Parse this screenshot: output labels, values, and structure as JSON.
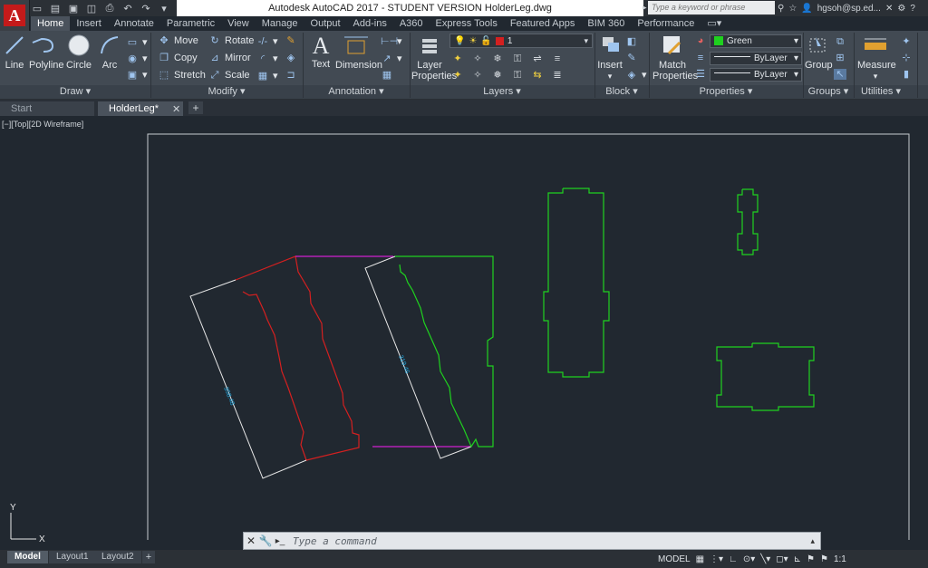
{
  "app": {
    "logo_letter": "A",
    "window_title": "Autodesk AutoCAD 2017 - STUDENT VERSION    HolderLeg.dwg",
    "search_placeholder": "Type a keyword or phrase",
    "user": "hgsoh@sp.ed...",
    "qat_icons": [
      "new-icon",
      "open-icon",
      "save-icon",
      "saveas-icon",
      "print-icon",
      "undo-icon",
      "redo-icon",
      "customize-icon"
    ]
  },
  "ribbon_tabs": [
    "Home",
    "Insert",
    "Annotate",
    "Parametric",
    "View",
    "Manage",
    "Output",
    "Add-ins",
    "A360",
    "Express Tools",
    "Featured Apps",
    "BIM 360",
    "Performance"
  ],
  "ribbon": {
    "draw": {
      "title": "Draw",
      "line": "Line",
      "polyline": "Polyline",
      "circle": "Circle",
      "arc": "Arc"
    },
    "modify": {
      "title": "Modify",
      "move": "Move",
      "rotate": "Rotate",
      "copy": "Copy",
      "mirror": "Mirror",
      "stretch": "Stretch",
      "scale": "Scale"
    },
    "annotation": {
      "title": "Annotation",
      "text": "Text",
      "dimension": "Dimension"
    },
    "layers": {
      "title": "Layers",
      "layer_properties_line1": "Layer",
      "layer_properties_line2": "Properties",
      "current_layer": "1"
    },
    "block": {
      "title": "Block",
      "insert": "Insert"
    },
    "properties": {
      "title": "Properties",
      "match_line1": "Match",
      "match_line2": "Properties",
      "color": "Green",
      "linetype": "ByLayer",
      "lineweight": "ByLayer"
    },
    "groups": {
      "title": "Groups",
      "group": "Group"
    },
    "utilities": {
      "title": "Utilities",
      "measure": "Measure"
    }
  },
  "file_tabs": {
    "start": "Start",
    "active": "HolderLeg*",
    "add": "+"
  },
  "viewport_label": "[−][Top][2D Wireframe]",
  "drawing": {
    "dimension_1": "358.48",
    "dimension_2": "319.46",
    "ucs_x": "X",
    "ucs_y": "Y"
  },
  "command": {
    "placeholder": "Type a command"
  },
  "layout_tabs": [
    "Model",
    "Layout1",
    "Layout2"
  ],
  "status": {
    "model": "MODEL",
    "scale": "1:1"
  },
  "colors": {
    "accent": "#c41a1a",
    "green_layer": "#1fd11f",
    "red_layer": "#d42020",
    "magenta": "#d020d0",
    "white": "#e8e8e8",
    "dim_text": "#1ea7e0",
    "canvas": "#212830"
  }
}
